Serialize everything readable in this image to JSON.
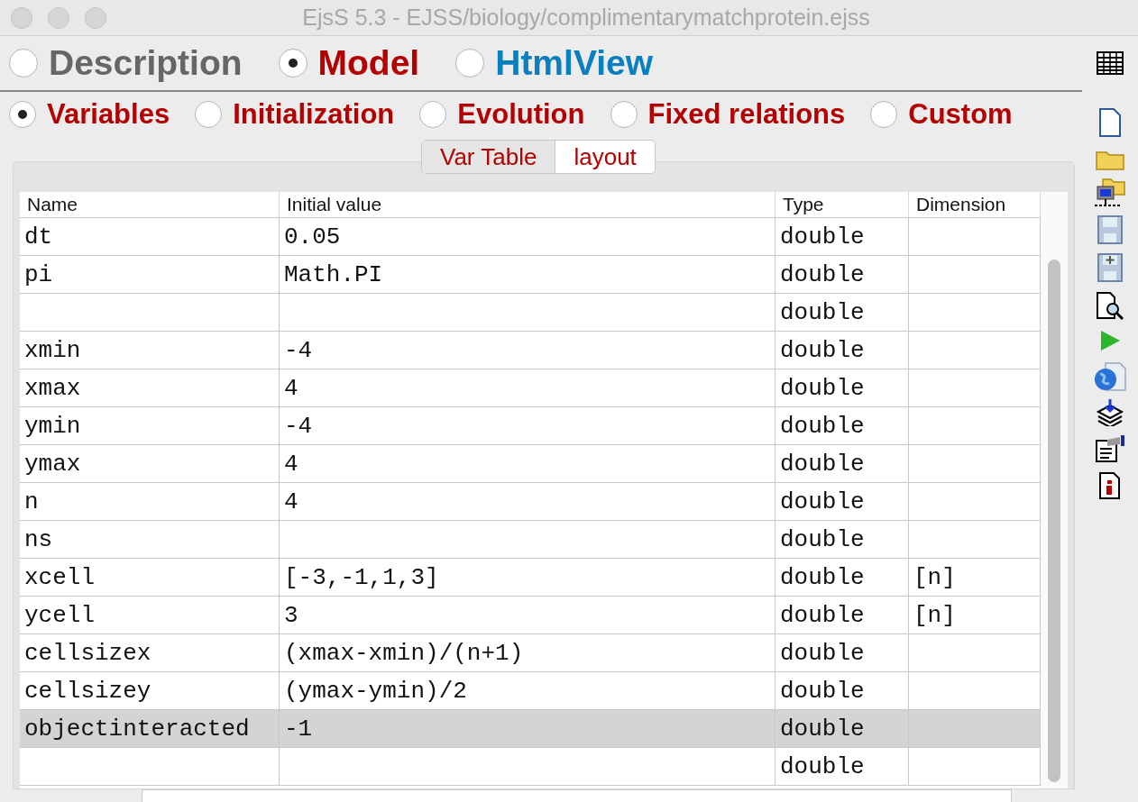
{
  "window": {
    "title": "EjsS 5.3 - EJSS/biology/complimentarymatchprotein.ejss"
  },
  "main_tabs": [
    {
      "label": "Description",
      "selected": false,
      "color": "#666666"
    },
    {
      "label": "Model",
      "selected": true,
      "color": "#b30000"
    },
    {
      "label": "HtmlView",
      "selected": false,
      "color": "#0a7fc0"
    }
  ],
  "model_tabs": [
    {
      "label": "Variables",
      "selected": true
    },
    {
      "label": "Initialization",
      "selected": false
    },
    {
      "label": "Evolution",
      "selected": false
    },
    {
      "label": "Fixed relations",
      "selected": false
    },
    {
      "label": "Custom",
      "selected": false
    }
  ],
  "page_tabs": [
    {
      "label": "Var Table",
      "selected": true
    },
    {
      "label": "layout",
      "selected": false
    }
  ],
  "table": {
    "columns": [
      "Name",
      "Initial value",
      "Type",
      "Dimension"
    ],
    "rows": [
      {
        "name": "dt",
        "initial_value": "0.05",
        "type": "double",
        "dimension": "",
        "selected": false
      },
      {
        "name": "pi",
        "initial_value": "Math.PI",
        "type": "double",
        "dimension": "",
        "selected": false
      },
      {
        "name": "",
        "initial_value": "",
        "type": "double",
        "dimension": "",
        "selected": false
      },
      {
        "name": "xmin",
        "initial_value": "-4",
        "type": "double",
        "dimension": "",
        "selected": false
      },
      {
        "name": "xmax",
        "initial_value": "4",
        "type": "double",
        "dimension": "",
        "selected": false
      },
      {
        "name": "ymin",
        "initial_value": "-4",
        "type": "double",
        "dimension": "",
        "selected": false
      },
      {
        "name": "ymax",
        "initial_value": "4",
        "type": "double",
        "dimension": "",
        "selected": false
      },
      {
        "name": "n",
        "initial_value": "4",
        "type": "double",
        "dimension": "",
        "selected": false
      },
      {
        "name": "ns",
        "initial_value": "",
        "type": "double",
        "dimension": "",
        "selected": false
      },
      {
        "name": "xcell",
        "initial_value": "[-3,-1,1,3]",
        "type": "double",
        "dimension": "[n]",
        "selected": false
      },
      {
        "name": "ycell",
        "initial_value": "3",
        "type": "double",
        "dimension": "[n]",
        "selected": false
      },
      {
        "name": "cellsizex",
        "initial_value": "(xmax-xmin)/(n+1)",
        "type": "double",
        "dimension": "",
        "selected": false
      },
      {
        "name": "cellsizey",
        "initial_value": "(ymax-ymin)/2",
        "type": "double",
        "dimension": "",
        "selected": false
      },
      {
        "name": "objectinteracted",
        "initial_value": "-1",
        "type": "double",
        "dimension": "",
        "selected": true
      },
      {
        "name": "",
        "initial_value": "",
        "type": "double",
        "dimension": "",
        "selected": false
      }
    ]
  }
}
